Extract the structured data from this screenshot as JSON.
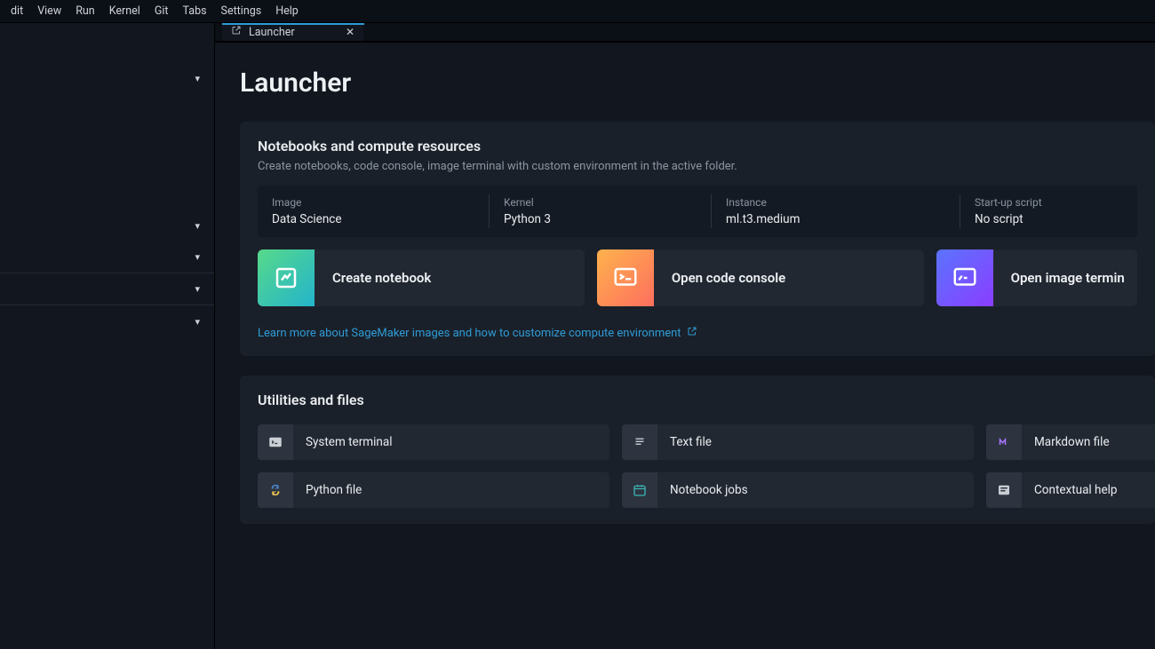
{
  "menubar": {
    "items": [
      "dit",
      "View",
      "Run",
      "Kernel",
      "Git",
      "Tabs",
      "Settings",
      "Help"
    ]
  },
  "tab": {
    "label": "Launcher"
  },
  "page": {
    "title": "Launcher"
  },
  "compute": {
    "title": "Notebooks and compute resources",
    "subtitle": "Create notebooks, code console, image terminal with custom environment in the active folder.",
    "env": {
      "image": {
        "label": "Image",
        "value": "Data Science"
      },
      "kernel": {
        "label": "Kernel",
        "value": "Python 3"
      },
      "instance": {
        "label": "Instance",
        "value": "ml.t3.medium"
      },
      "script": {
        "label": "Start-up script",
        "value": "No script"
      }
    },
    "cards": {
      "notebook": "Create notebook",
      "console": "Open code console",
      "terminal": "Open image termin"
    },
    "learn_more": "Learn more about SageMaker images and how to customize compute environment"
  },
  "utils": {
    "title": "Utilities and files",
    "items": {
      "system_terminal": "System terminal",
      "text_file": "Text file",
      "markdown_file": "Markdown file",
      "python_file": "Python file",
      "notebook_jobs": "Notebook jobs",
      "contextual_help": "Contextual help"
    }
  }
}
